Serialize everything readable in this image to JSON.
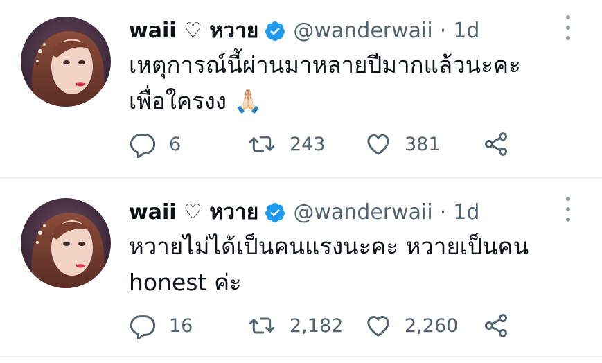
{
  "colors": {
    "text": "#0f1419",
    "muted": "#536471",
    "verified": "#1d9bf0",
    "divider": "#eceef0"
  },
  "tweets": [
    {
      "display_name": "waii ♡ หวาย",
      "handle": "@wanderwaii",
      "separator": "·",
      "time": "1d",
      "text_lines": [
        "เหตุการณ์นี้ผ่านมาหลายปีมากแล้วนะคะ",
        "เพื่อใครงง 🙏🏻"
      ],
      "replies": "6",
      "retweets": "243",
      "likes": "381",
      "icons": [
        "reply-icon",
        "retweet-icon",
        "like-icon",
        "share-icon",
        "more-icon",
        "verified-icon"
      ]
    },
    {
      "display_name": "waii ♡ หวาย",
      "handle": "@wanderwaii",
      "separator": "·",
      "time": "1d",
      "text_lines": [
        "หวายไม่ได้เป็นคนแรงนะคะ หวายเป็นคน",
        "honest ค่ะ"
      ],
      "replies": "16",
      "retweets": "2,182",
      "likes": "2,260",
      "icons": [
        "reply-icon",
        "retweet-icon",
        "like-icon",
        "share-icon",
        "more-icon",
        "verified-icon"
      ]
    }
  ]
}
